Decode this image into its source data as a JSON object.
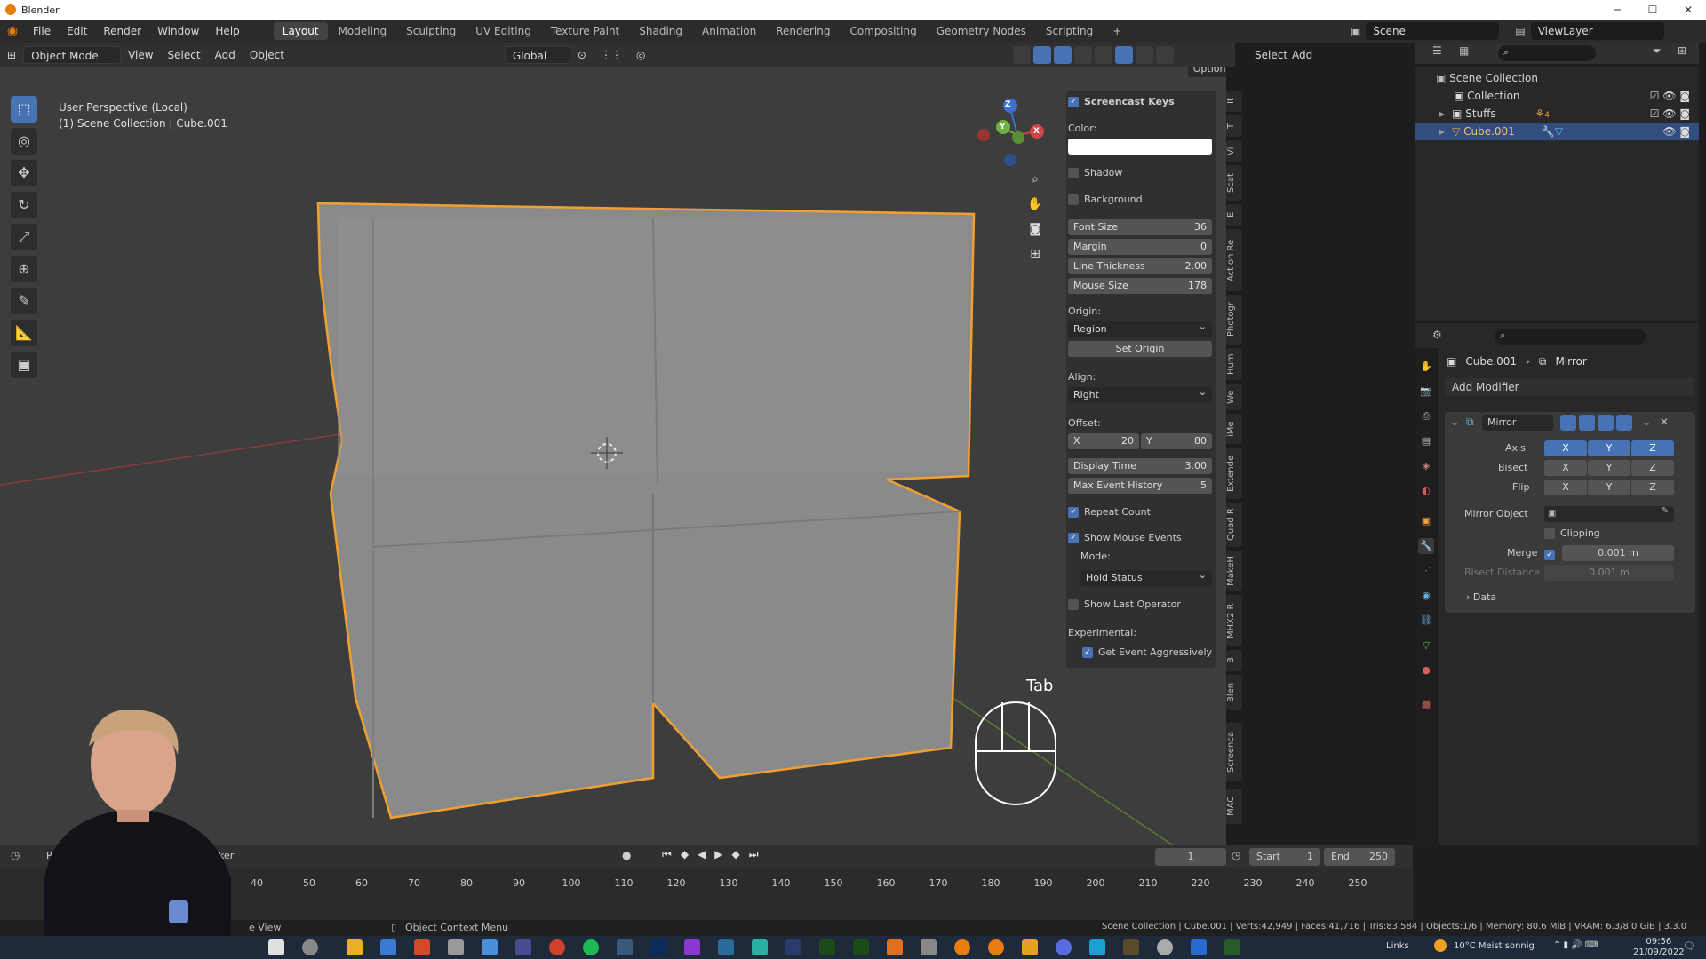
{
  "titlebar": {
    "title": "Blender",
    "minimize": "─",
    "maximize": "☐",
    "close": "✕"
  },
  "menu": {
    "items": [
      "File",
      "Edit",
      "Render",
      "Window",
      "Help"
    ]
  },
  "workspaces": [
    "Layout",
    "Modeling",
    "Sculpting",
    "UV Editing",
    "Texture Paint",
    "Shading",
    "Animation",
    "Rendering",
    "Compositing",
    "Geometry Nodes",
    "Scripting"
  ],
  "scene": {
    "name": "Scene",
    "view_layer": "ViewLayer"
  },
  "viewport_header": {
    "mode": "Object Mode",
    "menus": [
      "View",
      "Select",
      "Add",
      "Object"
    ],
    "transform": "Global",
    "options": "Options"
  },
  "viewport": {
    "info_line1": "User Perspective (Local)",
    "info_line2": "(1) Scene Collection | Cube.001",
    "key_display": "Tab"
  },
  "gizmo": {
    "x": "X",
    "y": "Y",
    "z": "Z"
  },
  "npanel": {
    "header": "Screencast Keys",
    "color_label": "Color:",
    "shadow": "Shadow",
    "background": "Background",
    "font_size_label": "Font Size",
    "font_size": "36",
    "margin_label": "Margin",
    "margin": "0",
    "line_thickness_label": "Line Thickness",
    "line_thickness": "2.00",
    "mouse_size_label": "Mouse Size",
    "mouse_size": "178",
    "origin_label": "Origin:",
    "origin": "Region",
    "set_origin": "Set Origin",
    "align_label": "Align:",
    "align": "Right",
    "offset_label": "Offset:",
    "offset_x_label": "X",
    "offset_x": "20",
    "offset_y_label": "Y",
    "offset_y": "80",
    "display_time_label": "Display Time",
    "display_time": "3.00",
    "max_event_label": "Max Event History",
    "max_event": "5",
    "repeat_count": "Repeat Count",
    "show_mouse_events": "Show Mouse Events",
    "mode_label": "Mode:",
    "mode": "Hold Status",
    "show_last_operator": "Show Last Operator",
    "experimental_label": "Experimental:",
    "get_event": "Get Event Aggressively"
  },
  "vtabs": [
    "It",
    "T",
    "Vi",
    "Scat",
    "E",
    "Action Re",
    "Photogr",
    "Hum",
    "We",
    "iMe",
    "Extende",
    "Quad R",
    "MakeH",
    "MHX2 R",
    "B",
    "Blen",
    "Screenca",
    "MAC"
  ],
  "outliner": {
    "root": "Scene Collection",
    "items": [
      "Collection",
      "Stuffs",
      "Cube.001"
    ],
    "stuffs_count": "4"
  },
  "properties": {
    "breadcrumb_object": "Cube.001",
    "breadcrumb_mod": "Mirror",
    "add_modifier": "Add Modifier",
    "modifier_name": "Mirror",
    "axis_label": "Axis",
    "bisect_label": "Bisect",
    "flip_label": "Flip",
    "x": "X",
    "y": "Y",
    "z": "Z",
    "mirror_object_label": "Mirror Object",
    "clipping": "Clipping",
    "merge_label": "Merge",
    "merge_value": "0.001 m",
    "bisect_distance_label": "Bisect Distance",
    "bisect_distance_value": "0.001 m",
    "data": "Data"
  },
  "timeline": {
    "playback": "Pla",
    "keying": "ker",
    "current_frame": "1",
    "start_label": "Start",
    "start": "1",
    "end_label": "End",
    "end": "250",
    "frames": [
      "40",
      "50",
      "60",
      "70",
      "80",
      "90",
      "100",
      "110",
      "120",
      "130",
      "140",
      "150",
      "160",
      "170",
      "180",
      "190",
      "200",
      "210",
      "220",
      "230",
      "240",
      "250"
    ]
  },
  "statusbar": {
    "left": "e View",
    "context": "Object Context Menu",
    "stats": "Scene Collection | Cube.001 | Verts:42,949 | Faces:41,716 | Tris:83,584 | Objects:1/6 | Memory: 80.6 MiB | VRAM: 6.3/8.0 GiB | 3.3.0"
  },
  "taskbar": {
    "links": "Links",
    "weather": "10°C  Meist sonnig",
    "time": "09:56",
    "date": "21/09/2022"
  },
  "colors": {
    "accent": "#4772b3",
    "selection_outline": "#f0a030",
    "brand": "#e87d0d"
  }
}
